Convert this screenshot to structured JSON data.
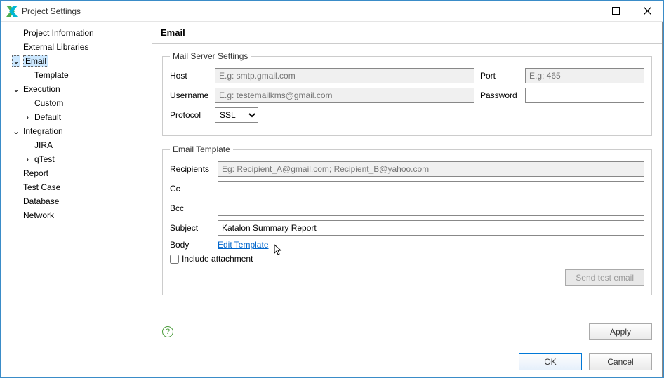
{
  "window": {
    "title": "Project Settings"
  },
  "sidebar": {
    "items": [
      {
        "label": "Project Information",
        "level": 1,
        "expandable": false
      },
      {
        "label": "External Libraries",
        "level": 1,
        "expandable": false
      },
      {
        "label": "Email",
        "level": 1,
        "expandable": true,
        "expanded": true,
        "selected": true
      },
      {
        "label": "Template",
        "level": 2
      },
      {
        "label": "Execution",
        "level": 1,
        "expandable": true,
        "expanded": true
      },
      {
        "label": "Custom",
        "level": 2
      },
      {
        "label": "Default",
        "level": 2,
        "expandable": true,
        "expanded": false
      },
      {
        "label": "Integration",
        "level": 1,
        "expandable": true,
        "expanded": true
      },
      {
        "label": "JIRA",
        "level": 2
      },
      {
        "label": "qTest",
        "level": 2,
        "expandable": true,
        "expanded": false
      },
      {
        "label": "Report",
        "level": 1,
        "expandable": false
      },
      {
        "label": "Test Case",
        "level": 1,
        "expandable": false
      },
      {
        "label": "Database",
        "level": 1,
        "expandable": false
      },
      {
        "label": "Network",
        "level": 1,
        "expandable": false
      }
    ]
  },
  "page": {
    "heading": "Email",
    "mail": {
      "legend": "Mail Server Settings",
      "host_label": "Host",
      "host_placeholder": "E.g: smtp.gmail.com",
      "port_label": "Port",
      "port_placeholder": "E.g: 465",
      "user_label": "Username",
      "user_placeholder": "E.g: testemailkms@gmail.com",
      "pass_label": "Password",
      "protocol_label": "Protocol",
      "protocol_value": "SSL"
    },
    "template": {
      "legend": "Email Template",
      "recipients_label": "Recipients",
      "recipients_placeholder": "Eg: Recipient_A@gmail.com; Recipient_B@yahoo.com",
      "cc_label": "Cc",
      "bcc_label": "Bcc",
      "subject_label": "Subject",
      "subject_value": "Katalon Summary Report",
      "body_label": "Body",
      "edit_template": "Edit Template",
      "include_attachment": "Include attachment",
      "send_test": "Send test email"
    },
    "apply": "Apply",
    "help": "?"
  },
  "buttons": {
    "ok": "OK",
    "cancel": "Cancel"
  }
}
